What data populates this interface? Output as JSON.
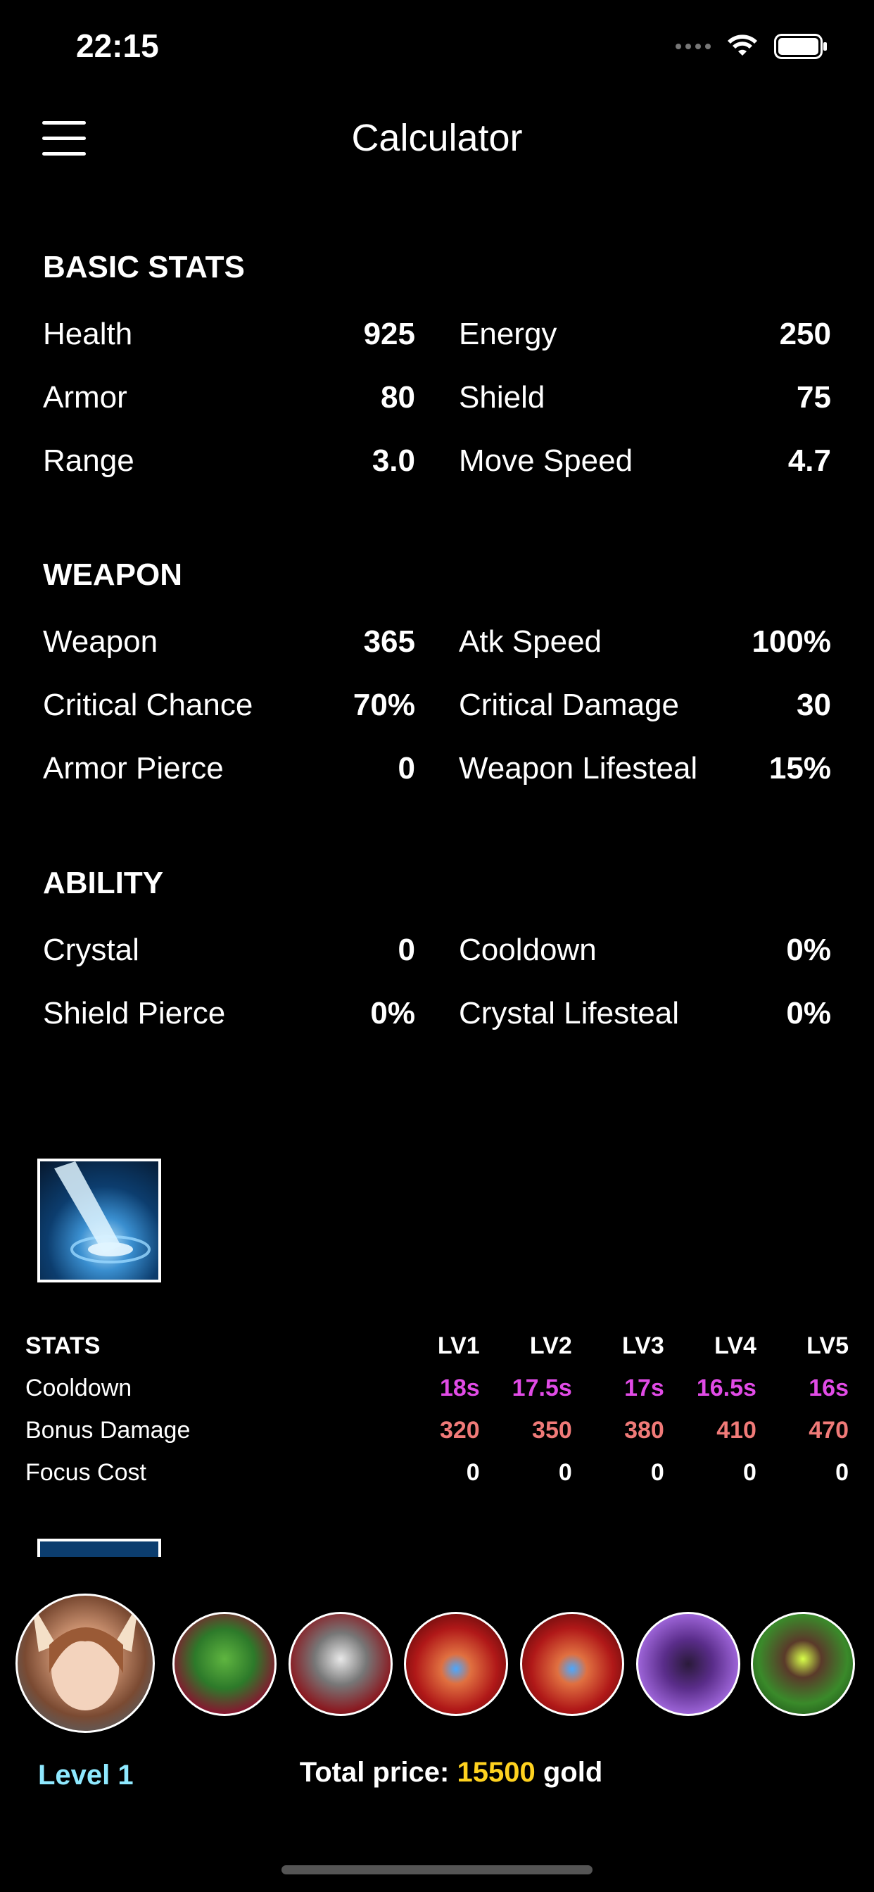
{
  "status_bar": {
    "time": "22:15"
  },
  "nav": {
    "title": "Calculator"
  },
  "sections": [
    {
      "title": "BASIC STATS",
      "rows": [
        [
          {
            "label": "Health",
            "value": "925"
          },
          {
            "label": "Energy",
            "value": "250"
          }
        ],
        [
          {
            "label": "Armor",
            "value": "80"
          },
          {
            "label": "Shield",
            "value": "75"
          }
        ],
        [
          {
            "label": "Range",
            "value": "3.0"
          },
          {
            "label": "Move Speed",
            "value": "4.7"
          }
        ]
      ]
    },
    {
      "title": "WEAPON",
      "rows": [
        [
          {
            "label": "Weapon",
            "value": "365"
          },
          {
            "label": "Atk Speed",
            "value": "100%"
          }
        ],
        [
          {
            "label": "Critical Chance",
            "value": "70%"
          },
          {
            "label": "Critical Damage",
            "value": "30"
          }
        ],
        [
          {
            "label": "Armor Pierce",
            "value": "0"
          },
          {
            "label": "Weapon Lifesteal",
            "value": "15%"
          }
        ]
      ]
    },
    {
      "title": "ABILITY",
      "rows": [
        [
          {
            "label": "Crystal",
            "value": "0"
          },
          {
            "label": "Cooldown",
            "value": "0%"
          }
        ],
        [
          {
            "label": "Shield Pierce",
            "value": "0%"
          },
          {
            "label": "Crystal Lifesteal",
            "value": "0%"
          }
        ]
      ]
    }
  ],
  "ability_table": {
    "header": {
      "label": "STATS",
      "levels": [
        "LV1",
        "LV2",
        "LV3",
        "LV4",
        "LV5"
      ]
    },
    "rows": [
      {
        "label": "Cooldown",
        "color": "#e14be6",
        "values": [
          "18s",
          "17.5s",
          "17s",
          "16.5s",
          "16s"
        ]
      },
      {
        "label": "Bonus Damage",
        "color": "#f07a78",
        "values": [
          "320",
          "350",
          "380",
          "410",
          "470"
        ]
      },
      {
        "label": "Focus Cost",
        "color": "#ffffff",
        "values": [
          "0",
          "0",
          "0",
          "0",
          "0"
        ]
      }
    ]
  },
  "footer": {
    "level": "Level 1",
    "level_color": "#8fe9ff",
    "total_prefix": "Total price:",
    "total_amount": "15500",
    "total_suffix": "gold",
    "amount_color": "#ffd21f"
  },
  "items": [
    "green-helmet-item",
    "sword-item",
    "red-belt-item",
    "red-belt-item",
    "purple-boots-item",
    "green-armor-item"
  ]
}
